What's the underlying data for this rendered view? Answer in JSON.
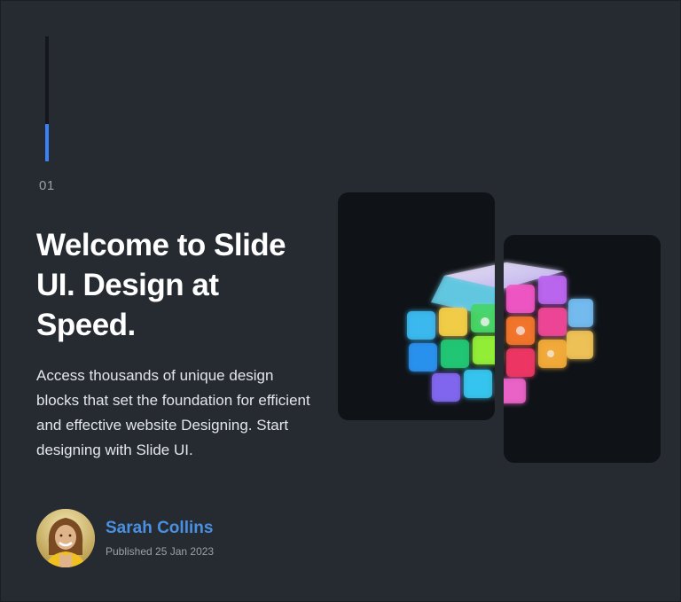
{
  "slide": {
    "number": "01",
    "progress_fraction": 0.3
  },
  "hero": {
    "title": "Welcome to Slide UI. Design at Speed.",
    "description": "Access thousands of unique design blocks that set the foundation for efficient and effective website Designing. Start designing with Slide UI."
  },
  "author": {
    "name": "Sarah Collins",
    "published": "Published 25 Jan 2023"
  },
  "colors": {
    "background": "#262b31",
    "card": "#0f1317",
    "accent": "#3b82f6",
    "author_name": "#4a90e2"
  },
  "images": {
    "hero_image": "glowing-rubiks-cube",
    "avatar": "sarah-collins-photo"
  }
}
